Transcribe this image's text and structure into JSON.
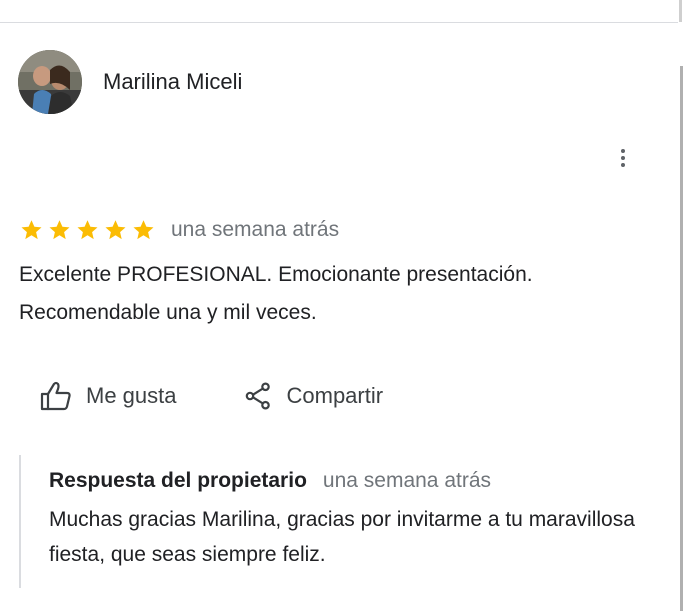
{
  "review": {
    "reviewer_name": "Marilina Miceli",
    "rating": 5,
    "max_rating": 5,
    "time_ago": "una semana atrás",
    "text": "Excelente PROFESIONAL. Emocionante presentación. Recomendable una y mil veces.",
    "more_options_icon": "more-vert-icon",
    "star_color": "#fbbc04"
  },
  "actions": {
    "like_label": "Me gusta",
    "like_icon": "thumb-up-icon",
    "share_label": "Compartir",
    "share_icon": "share-icon"
  },
  "owner_reply": {
    "title": "Respuesta del propietario",
    "time_ago": "una semana atrás",
    "text": "Muchas gracias Marilina, gracias por invitarme a tu maravillosa fiesta, que seas siempre feliz."
  }
}
